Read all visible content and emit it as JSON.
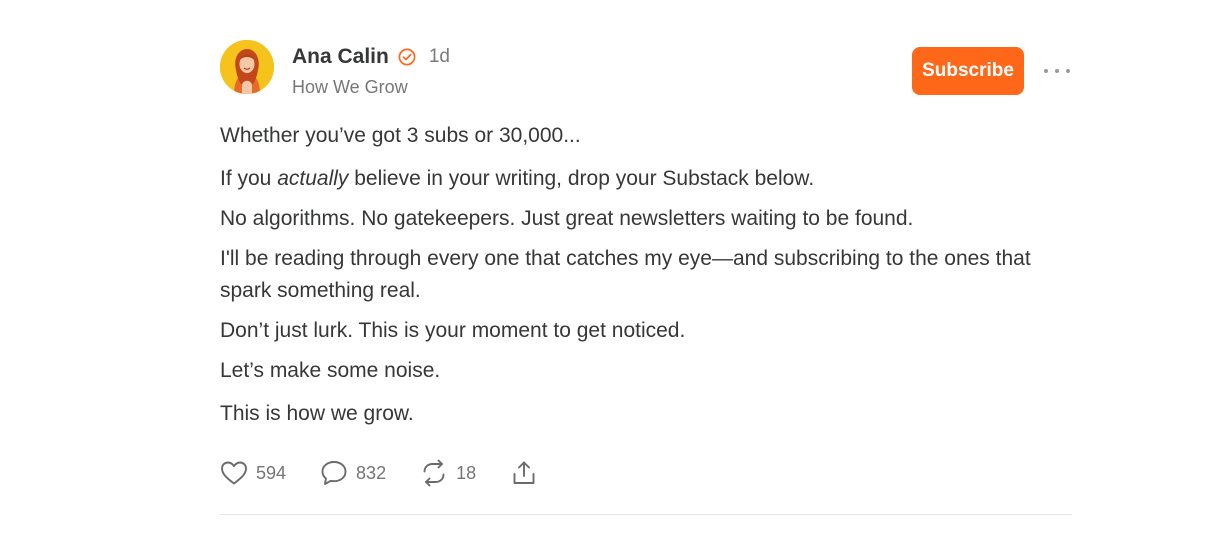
{
  "author": {
    "name": "Ana Calin",
    "time": "1d",
    "publication": "How We Grow"
  },
  "subscribe_label": "Subscribe",
  "post": {
    "line1": "Whether you’ve got 3 subs or 30,000...",
    "line2_pre": "If you ",
    "line2_em": "actually",
    "line2_post": " believe in your writing, drop your Substack below.",
    "line3": "No algorithms. No gatekeepers. Just great newsletters waiting to be found.",
    "line4": "I'll be reading through every one that catches my eye—and subscribing to the ones that spark something real.",
    "line5": "Don’t just lurk. This is your moment to get noticed.",
    "line6": "Let’s make some noise.",
    "line7": "This is how we grow."
  },
  "actions": {
    "likes": "594",
    "comments": "832",
    "restacks": "18"
  },
  "icons": {
    "verified": "verified-check-icon",
    "like": "heart-icon",
    "comment": "comment-bubble-icon",
    "restack": "restack-arrows-icon",
    "share": "share-icon",
    "more": "ellipsis-icon"
  },
  "colors": {
    "accent": "#ff6719",
    "text": "#363737",
    "muted": "#777777",
    "avatar_bg": "#f6c21c"
  }
}
